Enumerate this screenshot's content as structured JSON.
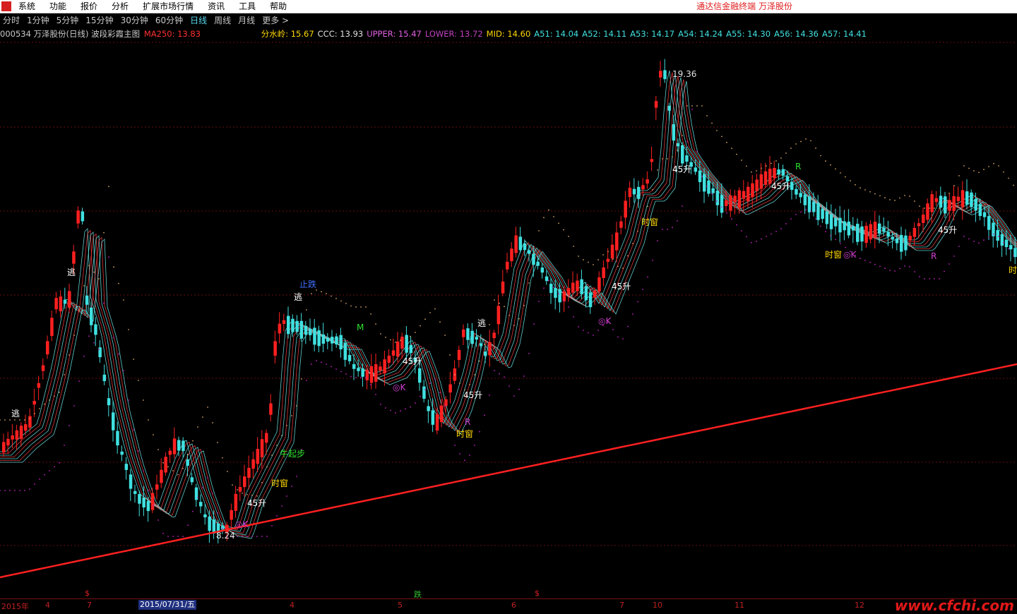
{
  "menubar": {
    "items": [
      "系统",
      "功能",
      "报价",
      "分析",
      "扩展市场行情",
      "资讯",
      "工具",
      "帮助"
    ],
    "brand": "通达信金融终端   万泽股份"
  },
  "periods": [
    "分时",
    "1分钟",
    "5分钟",
    "15分钟",
    "30分钟",
    "60分钟",
    "日线",
    "周线",
    "月线",
    "更多 >"
  ],
  "active_period": "日线",
  "indicator_line": {
    "code_title": "000534 万泽股份(日线) 波段彩霞主图",
    "ma250_label": "MA250: 13.83",
    "values": [
      {
        "text": "分水岭: 15.67",
        "color": "#ffd800"
      },
      {
        "text": "CCC: 13.93",
        "color": "#e0e0e0"
      },
      {
        "text": "UPPER: 15.47",
        "color": "#e060e0"
      },
      {
        "text": "LOWER: 13.72",
        "color": "#c040c0"
      },
      {
        "text": "MID: 14.60",
        "color": "#ffd800"
      },
      {
        "text": "A51: 14.04",
        "color": "#40e0e0"
      },
      {
        "text": "A52: 14.11",
        "color": "#40e0e0"
      },
      {
        "text": "A53: 14.17",
        "color": "#40e0e0"
      },
      {
        "text": "A54: 14.24",
        "color": "#40e0e0"
      },
      {
        "text": "A55: 14.30",
        "color": "#40e0e0"
      },
      {
        "text": "A56: 14.36",
        "color": "#40e0e0"
      },
      {
        "text": "A57: 14.41",
        "color": "#40e0e0"
      }
    ]
  },
  "chart_annotations": {
    "high_label": "19.36",
    "low_label": "8.24",
    "escape": "逃",
    "stop_drop": "止跌",
    "start": "牛起步",
    "time_window": "时窗",
    "rise45": "45升",
    "k_mark": "◎K",
    "m_mark": "M",
    "r_mark": "R"
  },
  "x_axis": {
    "labels": [
      "2015年",
      "4",
      "7",
      "4",
      "5",
      "6",
      "7",
      "10",
      "11",
      "12"
    ],
    "cursor_date": "2015/07/31/五",
    "markers": [
      "$",
      "跌",
      "$"
    ]
  },
  "colors": {
    "up": "#ff2020",
    "down": "#40e0e0",
    "ma250": "#ff2020",
    "band": "#c020c0"
  },
  "watermark": "www.cfchi.com"
}
